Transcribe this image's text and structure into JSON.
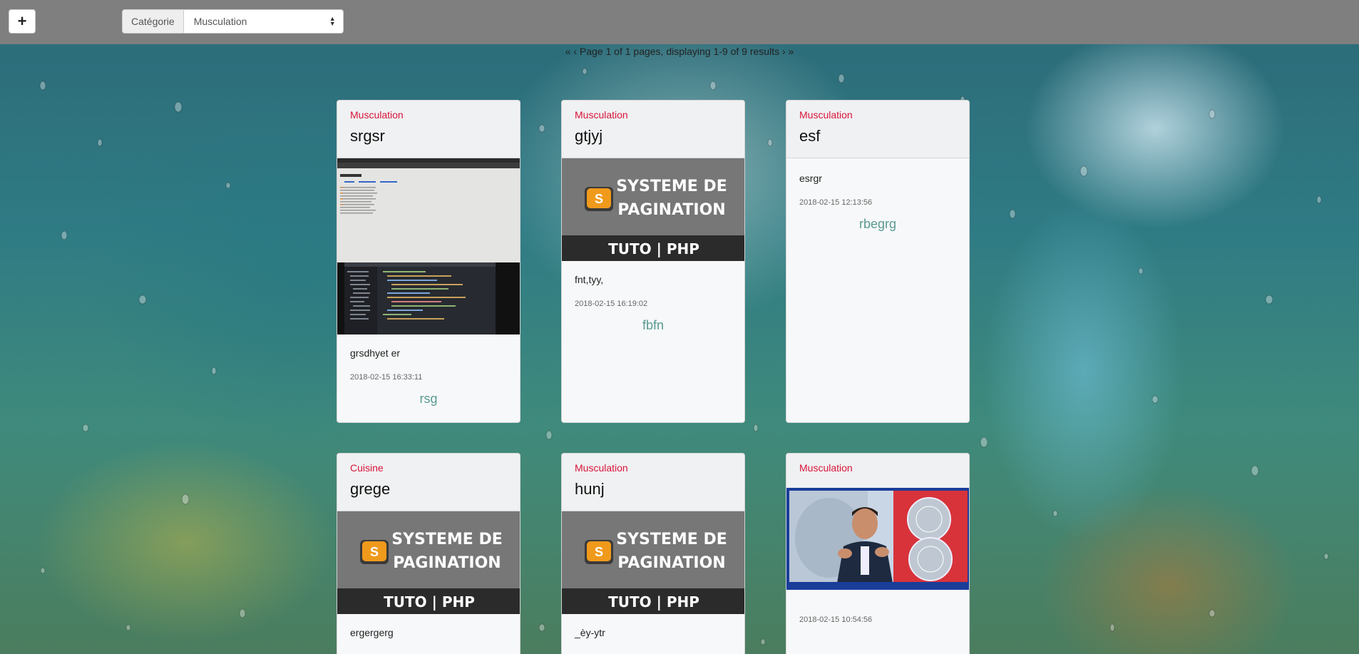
{
  "toolbar": {
    "add_label": "+",
    "category_label": "Catégorie",
    "category_value": "Musculation"
  },
  "pager": {
    "first": "«",
    "prev": "‹",
    "text": "Page 1 of 1 pages, displaying 1-9 of 9 results",
    "next": "›",
    "last": "»"
  },
  "banner": {
    "line1": "SYSTEME DE",
    "line2": "PAGINATION",
    "footer": "TUTO | PHP",
    "logo_letter": "S"
  },
  "cards": [
    {
      "category": "Musculation",
      "title": "srgsr",
      "image": "screenshot",
      "text": "grsdhyet er",
      "date": "2018-02-15 16:33:11",
      "link": "rsg"
    },
    {
      "category": "Musculation",
      "title": "gtjyj",
      "image": "pagination-banner",
      "text": "fnt,tyy,",
      "date": "2018-02-15 16:19:02",
      "link": "fbfn"
    },
    {
      "category": "Musculation",
      "title": "esf",
      "image": "none",
      "text": "esrgr",
      "date": "2018-02-15 12:13:56",
      "link": "rbegrg"
    },
    {
      "category": "Cuisine",
      "title": "grege",
      "image": "pagination-banner",
      "text": "ergergerg",
      "date": "",
      "link": ""
    },
    {
      "category": "Musculation",
      "title": "hunj",
      "image": "pagination-banner",
      "text": "_èy-ytr",
      "date": "",
      "link": ""
    },
    {
      "category": "Musculation",
      "title": "",
      "image": "tv-photo",
      "text": "",
      "date": "2018-02-15 10:54:56",
      "link": ""
    }
  ],
  "colors": {
    "topbar": "#7f7f7f",
    "category": "#d9143a",
    "link": "#5a9a93"
  }
}
